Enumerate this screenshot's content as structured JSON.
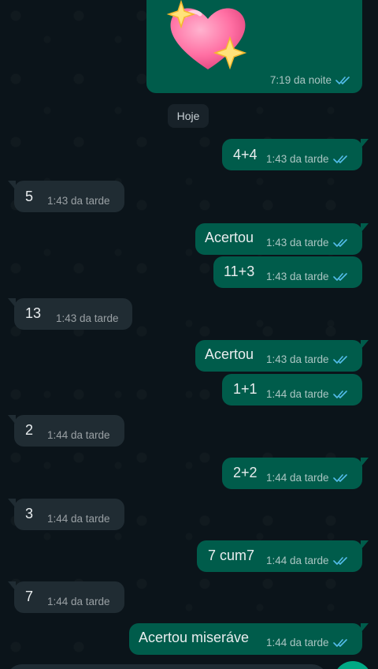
{
  "colors": {
    "chat_bg": "#0b141a",
    "outgoing_bubble": "#005c4b",
    "incoming_bubble": "#202c33",
    "read_ticks": "#53bdeb",
    "accent": "#00a884"
  },
  "date_separator": "Hoje",
  "messages": [
    {
      "id": "m0",
      "direction": "out",
      "text": "",
      "sticker": "sparkling-heart-emoji",
      "time": "7:19 da noite",
      "status": "read"
    },
    {
      "id": "m1",
      "direction": "out",
      "text": "4+4",
      "time": "1:43 da tarde",
      "status": "read"
    },
    {
      "id": "m2",
      "direction": "in",
      "text": "5",
      "time": "1:43 da tarde"
    },
    {
      "id": "m3",
      "direction": "out",
      "text": "Acertou",
      "time": "1:43 da tarde",
      "status": "read"
    },
    {
      "id": "m4",
      "direction": "out",
      "text": "11+3",
      "time": "1:43 da tarde",
      "status": "read"
    },
    {
      "id": "m5",
      "direction": "in",
      "text": "13",
      "time": "1:43 da tarde"
    },
    {
      "id": "m6",
      "direction": "out",
      "text": "Acertou",
      "time": "1:43 da tarde",
      "status": "read"
    },
    {
      "id": "m7",
      "direction": "out",
      "text": "1+1",
      "time": "1:44 da tarde",
      "status": "read"
    },
    {
      "id": "m8",
      "direction": "in",
      "text": "2",
      "time": "1:44 da tarde"
    },
    {
      "id": "m9",
      "direction": "out",
      "text": "2+2",
      "time": "1:44 da tarde",
      "status": "read"
    },
    {
      "id": "m10",
      "direction": "in",
      "text": "3",
      "time": "1:44 da tarde"
    },
    {
      "id": "m11",
      "direction": "out",
      "text": "7 cum7",
      "time": "1:44 da tarde",
      "status": "read"
    },
    {
      "id": "m12",
      "direction": "in",
      "text": "7",
      "time": "1:44 da tarde"
    },
    {
      "id": "m13",
      "direction": "out",
      "text": "Acertou miseráve",
      "time": "1:44 da tarde",
      "status": "read"
    }
  ]
}
